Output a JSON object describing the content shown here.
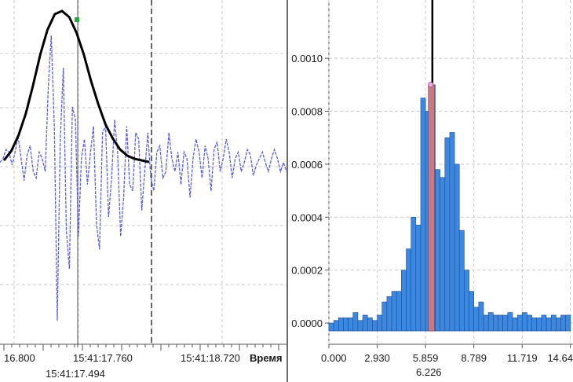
{
  "chart_data": [
    {
      "type": "line",
      "panel": "waveform",
      "xlabel": "Время",
      "x_tick_labels": [
        "16.800",
        "15:41:17.760",
        "15:41:18.720"
      ],
      "cursor_label": "15:41:17.494",
      "grid": true,
      "series": [
        {
          "style": "blue dashed oscillating waveform",
          "color": "#5a5ee0",
          "x": [
            0.0,
            0.02,
            0.04,
            0.06,
            0.08,
            0.1,
            0.12,
            0.14,
            0.16,
            0.18,
            0.2,
            0.22,
            0.24,
            0.26,
            0.28,
            0.3,
            0.32,
            0.34,
            0.36,
            0.38,
            0.4,
            0.42,
            0.44,
            0.46,
            0.48,
            0.5,
            0.52,
            0.54,
            0.56,
            0.58,
            0.6,
            0.62,
            0.64,
            0.66,
            0.68,
            0.7,
            0.72,
            0.74,
            0.76,
            0.78,
            0.8,
            0.82,
            0.84,
            0.86,
            0.88,
            0.9,
            0.92,
            0.94,
            0.96,
            0.98,
            1.0,
            1.02,
            1.04,
            1.06,
            1.08,
            1.1,
            1.12,
            1.14,
            1.16,
            1.18,
            1.2,
            1.22,
            1.24,
            1.26,
            1.28,
            1.3,
            1.32,
            1.34,
            1.36,
            1.38,
            1.4,
            1.42,
            1.44,
            1.46,
            1.48,
            1.5,
            1.52,
            1.54,
            1.56,
            1.58,
            1.6,
            1.62,
            1.64,
            1.66,
            1.68,
            1.7,
            1.72,
            1.74,
            1.76,
            1.78,
            1.8,
            1.82,
            1.84,
            1.86,
            1.88,
            1.9
          ],
          "y": [
            0.02,
            0.05,
            0.12,
            0.1,
            0.0,
            0.1,
            0.22,
            0.05,
            -0.12,
            0.08,
            0.15,
            -0.05,
            -0.1,
            0.1,
            0.05,
            -0.05,
            0.6,
            1.0,
            0.3,
            -1.2,
            0.2,
            0.75,
            -0.5,
            -0.8,
            0.45,
            0.35,
            -0.55,
            0.05,
            0.2,
            -0.15,
            0.1,
            0.3,
            -0.45,
            -0.65,
            0.25,
            0.3,
            -0.4,
            -0.1,
            0.35,
            0.1,
            -0.55,
            -0.25,
            0.3,
            -0.15,
            -0.2,
            0.25,
            0.2,
            -0.35,
            -0.05,
            0.25,
            -0.1,
            -0.2,
            0.1,
            0.15,
            -0.1,
            -0.05,
            0.25,
            0.05,
            -0.05,
            0.1,
            -0.15,
            0.1,
            0.05,
            -0.25,
            0.05,
            0.2,
            0.1,
            -0.1,
            0.15,
            0.05,
            -0.2,
            0.12,
            0.18,
            -0.05,
            0.05,
            0.2,
            0.1,
            -0.1,
            0.05,
            0.1,
            -0.05,
            0.02,
            0.12,
            0.08,
            -0.08,
            0.0,
            0.05,
            0.1,
            0.02,
            -0.05,
            0.05,
            0.12,
            0.05,
            -0.05,
            0.02,
            -0.05
          ]
        },
        {
          "style": "black gaussian envelope",
          "color": "#000000",
          "x": [
            0.0,
            0.05,
            0.1,
            0.15,
            0.2,
            0.25,
            0.3,
            0.35,
            0.4,
            0.45,
            0.5,
            0.55,
            0.6,
            0.65,
            0.7,
            0.75,
            0.8,
            0.85,
            0.9,
            0.95,
            1.0
          ],
          "y": [
            0.04,
            0.1,
            0.2,
            0.34,
            0.52,
            0.72,
            0.88,
            0.98,
            1.0,
            0.96,
            0.86,
            0.72,
            0.55,
            0.4,
            0.27,
            0.18,
            0.11,
            0.07,
            0.05,
            0.04,
            0.03
          ]
        }
      ]
    },
    {
      "type": "bar",
      "panel": "histogram",
      "y_tick_labels": [
        "0.0000",
        "0.0002",
        "0.0004",
        "0.0006",
        "0.0008",
        "0.0010"
      ],
      "ylim": [
        -8e-05,
        0.00122
      ],
      "x_tick_labels": [
        "0.000",
        "2.930",
        "5.859",
        "8.789",
        "11.719",
        "14.64"
      ],
      "xlim": [
        0.0,
        14.8
      ],
      "cursor_label": "6.226",
      "cursor_value": 6.226,
      "grid": true,
      "bar_color": "#3c87e0",
      "highlight_color": "#c87a84",
      "bar_width": 0.293,
      "bar_starts": [
        0.0,
        0.293,
        0.586,
        0.879,
        1.172,
        1.465,
        1.758,
        2.051,
        2.344,
        2.637,
        2.93,
        3.223,
        3.516,
        3.809,
        4.102,
        4.395,
        4.688,
        4.981,
        5.274,
        5.567,
        5.86,
        6.153,
        6.446,
        6.739,
        7.032,
        7.325,
        7.618,
        7.911,
        8.204,
        8.497,
        8.79,
        9.083,
        9.376,
        9.669,
        9.962,
        10.255,
        10.548,
        10.841,
        11.134,
        11.427,
        11.72,
        12.013,
        12.306,
        12.599,
        12.892,
        13.185,
        13.478,
        13.771,
        14.064,
        14.357
      ],
      "values": [
        0.0,
        1e-05,
        2e-05,
        2e-05,
        2e-05,
        4e-05,
        1e-05,
        3e-05,
        2e-05,
        1e-05,
        3e-05,
        8e-05,
        0.0001,
        0.00012,
        0.00012,
        0.0002,
        0.00028,
        0.0004,
        0.00037,
        0.00085,
        0.0008,
        0.0009,
        0.00058,
        0.00055,
        0.0007,
        0.00072,
        0.0006,
        0.00035,
        0.0002,
        0.00012,
        6e-05,
        8e-05,
        3e-05,
        4e-05,
        3e-05,
        3e-05,
        3e-05,
        4e-05,
        2e-05,
        3e-05,
        4e-05,
        3e-05,
        2e-05,
        2e-05,
        3e-05,
        2e-05,
        3e-05,
        2e-05,
        3e-05,
        3e-05
      ]
    }
  ]
}
